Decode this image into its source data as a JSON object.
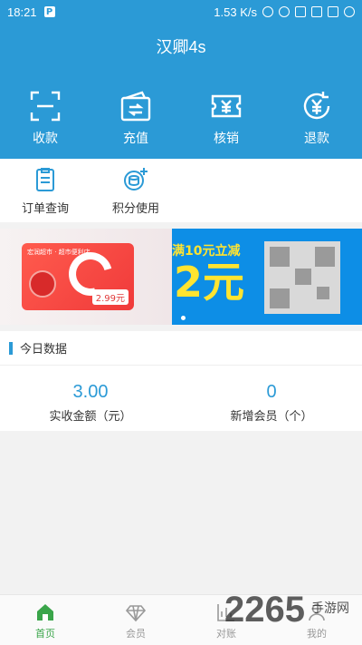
{
  "statusbar": {
    "time": "18:21",
    "network_speed": "1.53 K/s"
  },
  "header": {
    "title": "汉卿4s"
  },
  "quick_actions": [
    {
      "label": "收款",
      "icon": "scan-icon"
    },
    {
      "label": "充值",
      "icon": "wallet-icon"
    },
    {
      "label": "核销",
      "icon": "ticket-icon"
    },
    {
      "label": "退款",
      "icon": "refund-icon"
    }
  ],
  "functions": [
    {
      "label": "订单查询",
      "icon": "order-list-icon"
    },
    {
      "label": "积分使用",
      "icon": "points-icon"
    }
  ],
  "banner": {
    "card_title": "宏润超市 · 超市便利店",
    "card_price": "2.99元",
    "headline": "满10元立减",
    "amount": "2元"
  },
  "stats": {
    "title": "今日数据",
    "items": [
      {
        "value": "3.00",
        "label": "实收金额（元）"
      },
      {
        "value": "0",
        "label": "新增会员（个）"
      }
    ]
  },
  "bottom_nav": [
    {
      "label": "首页",
      "icon": "home-icon",
      "active": true
    },
    {
      "label": "会员",
      "icon": "diamond-icon",
      "active": false
    },
    {
      "label": "对账",
      "icon": "chart-icon",
      "active": false
    },
    {
      "label": "我的",
      "icon": "user-icon",
      "active": false
    }
  ],
  "watermark": {
    "big": "2265",
    "small": "手游网"
  },
  "colors": {
    "primary": "#2b9ad6",
    "active_nav": "#3aa54a",
    "banner_yellow": "#ffe431"
  }
}
